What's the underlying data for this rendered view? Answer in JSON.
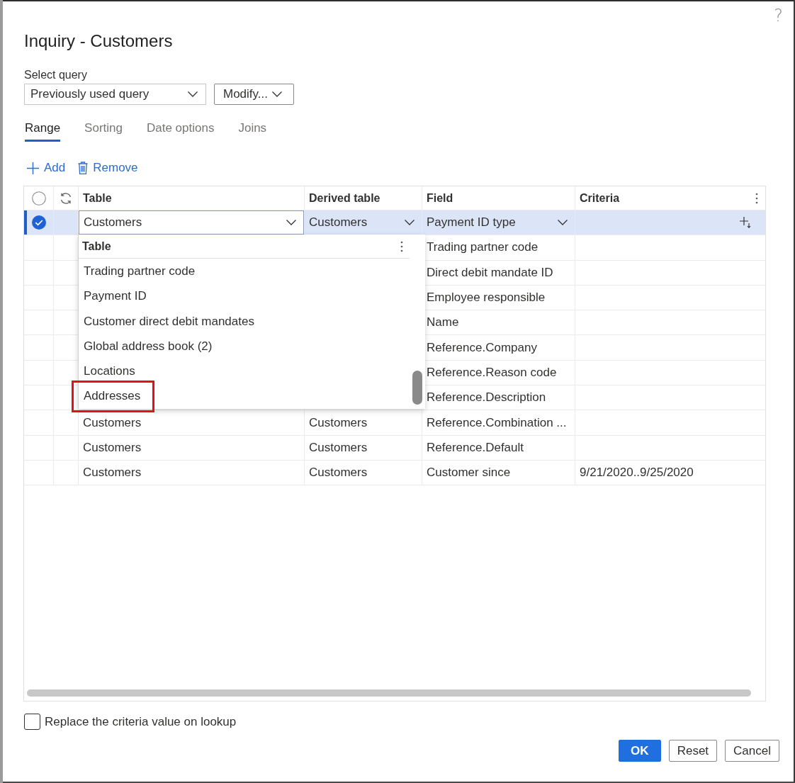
{
  "dialog": {
    "title": "Inquiry - Customers",
    "help": "?"
  },
  "query": {
    "label": "Select query",
    "value": "Previously used query",
    "modify_button": "Modify..."
  },
  "tabs": [
    {
      "label": "Range",
      "selected": true
    },
    {
      "label": "Sorting",
      "selected": false
    },
    {
      "label": "Date options",
      "selected": false
    },
    {
      "label": "Joins",
      "selected": false
    }
  ],
  "toolbar": [
    {
      "kind": "add",
      "label": "Add"
    },
    {
      "kind": "remove",
      "label": "Remove"
    }
  ],
  "grid": {
    "select_all": false,
    "columns": [
      "Table",
      "Derived table",
      "Field",
      "Criteria"
    ],
    "rows": [
      {
        "selected": true,
        "table": "Customers",
        "derived_table": "Customers",
        "field": "Payment ID type"
      },
      {
        "selected": false,
        "field": "Trading partner code"
      },
      {
        "selected": false,
        "field": "Direct debit mandate ID"
      },
      {
        "selected": false,
        "field": "Employee responsible"
      },
      {
        "selected": false,
        "field": "Name"
      },
      {
        "selected": false,
        "field": "Reference.Company"
      },
      {
        "selected": false,
        "field": "Reference.Reason code"
      },
      {
        "selected": false,
        "field": "Reference.Description"
      },
      {
        "selected": false,
        "table": "Customers",
        "derived_table": "Customers",
        "field": "Reference.Combination ..."
      },
      {
        "selected": false,
        "table": "Customers",
        "derived_table": "Customers",
        "field": "Reference.Default"
      },
      {
        "selected": false,
        "table": "Customers",
        "derived_table": "Customers",
        "field": "Customer since",
        "criteria": "9/21/2020..9/25/2020"
      }
    ]
  },
  "lookup": {
    "header": "Table",
    "items": [
      {
        "label": "Trading partner code",
        "highlighted": false
      },
      {
        "label": "Payment ID",
        "highlighted": false
      },
      {
        "label": "Customer direct debit mandates",
        "highlighted": false
      },
      {
        "label": "Global address book (2)",
        "highlighted": false
      },
      {
        "label": "Locations",
        "highlighted": false
      },
      {
        "label": "Addresses",
        "highlighted": true
      }
    ]
  },
  "replace_option": {
    "label": "Replace the criteria value on lookup",
    "checked": false
  },
  "buttons": [
    {
      "kind": "primary",
      "label": "OK"
    },
    {
      "kind": "default",
      "label": "Reset"
    },
    {
      "kind": "default",
      "label": "Cancel"
    }
  ]
}
